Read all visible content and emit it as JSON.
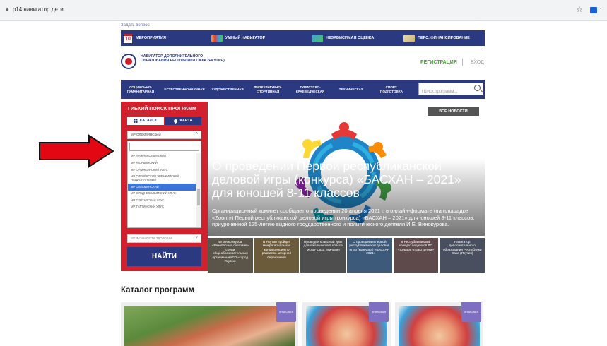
{
  "browser": {
    "url": "р14.навигатор.дети"
  },
  "site": {
    "ask_link": "Задать вопрос",
    "top_nav": [
      {
        "label": "МЕРОПРИЯТИЯ",
        "icon": "calendar-icon",
        "day": "10"
      },
      {
        "label": "УМНЫЙ НАВИГАТОР",
        "icon": "people-icon"
      },
      {
        "label": "НЕЗАВИСИМАЯ ОЦЕНКА",
        "icon": "chart-icon"
      },
      {
        "label": "ПЕРС. ФИНАНСИРОВАНИЕ",
        "icon": "certificate-icon"
      }
    ],
    "logo_text": "НАВИГАТОР ДОПОЛНИТЕЛЬНОГО ОБРАЗОВАНИЯ РЕСПУБЛИКИ САХА (ЯКУТИЯ)",
    "register": "РЕГИСТРАЦИЯ",
    "login": "ВХОД",
    "categories": [
      "СОЦИАЛЬНО-\nГУМАНИТАРНАЯ",
      "ЕСТЕСТВЕННОНАУЧНАЯ",
      "ХУДОЖЕСТВЕННАЯ",
      "ФИЗКУЛЬТУРНО-\nСПОРТИВНАЯ",
      "ТУРИСТСКО-\nКРАЕВЕДЧЕСКАЯ",
      "ТЕХНИЧЕСКАЯ",
      "СПОРТ.\nПОДГОТОВКА"
    ],
    "search_placeholder": "Поиск программ..."
  },
  "panel": {
    "title": "ГИБКИЙ ПОИСК ПРОГРАММ",
    "catalog_btn": "КАТАЛОГ",
    "map_btn": "КАРТА",
    "selected_value": "МР ОЛЁКМИНСКИЙ",
    "options": [
      "МР НИЖНЕКОЛЫМСКИЙ",
      "МР НЮРБИНСКИЙ",
      "МР ОЙМЯКОНСКИЙ УЛУС",
      "МР ОЛЕНЁКСКИЙ ЭВЕНКИЙСКИЙ НАЦИОНАЛЬНЫЙ",
      "МР ОЛЁКМИНСКИЙ",
      "МР СРЕДНЕКОЛЫМСКИЙ УЛУС",
      "МР СУНТАРСКИЙ УЛУС",
      "МР ТАТТИНСКИЙ УЛУС"
    ],
    "selected_index": 4,
    "bottom_select": "ВОЗМОЖНОСТИ ЗДОРОВЬЯ",
    "find_btn": "НАЙТИ"
  },
  "hero": {
    "all_news": "ВСЕ НОВОСТИ",
    "title": "О проведении Первой республиканской деловой игры (конкурса) «БАСХАН – 2021» для юношей 8-11 классов",
    "text": "Организационный комитет сообщает о проведении 20 апреля 2021 г. в онлайн-формате (на площадке «Zoom») Первой республиканской деловой игры (конкурса) «БАСХАН – 2021» для юношей 8-11 классов, приуроченной 125-летию видного государственного и политического деятеля И.Е. Винокурова.",
    "news": [
      "Итоги конкурса «Безопасный снеговик» среди общеобразовательных организаций ГО «город Якутск»",
      "В Якутии пройдёт межрегиональная конференция по развитию загорной бережливой",
      "Проведен классный урок для школьников 5 класса МОБУ Саха гимназия",
      "О проведении первой республиканской деловой игры (конкурса) «БАСХАН – 2021»",
      "II Республиканский конкурс педагогов ДО «Сердце отдаю детям»",
      "Навигатор дополнительного образования Республики Саха (Якутия)"
    ]
  },
  "catalog": {
    "title": "Каталог программ",
    "badges": [
      "ЗНАКОВАЯ",
      "ЗНАКОВАЯ",
      "ЗНАКОВАЯ"
    ]
  },
  "colors": {
    "navy": "#2a3980",
    "red": "#d2212c",
    "green": "#4a9e3a",
    "badge": "#7f6fc1",
    "arrow": "#e30613"
  }
}
